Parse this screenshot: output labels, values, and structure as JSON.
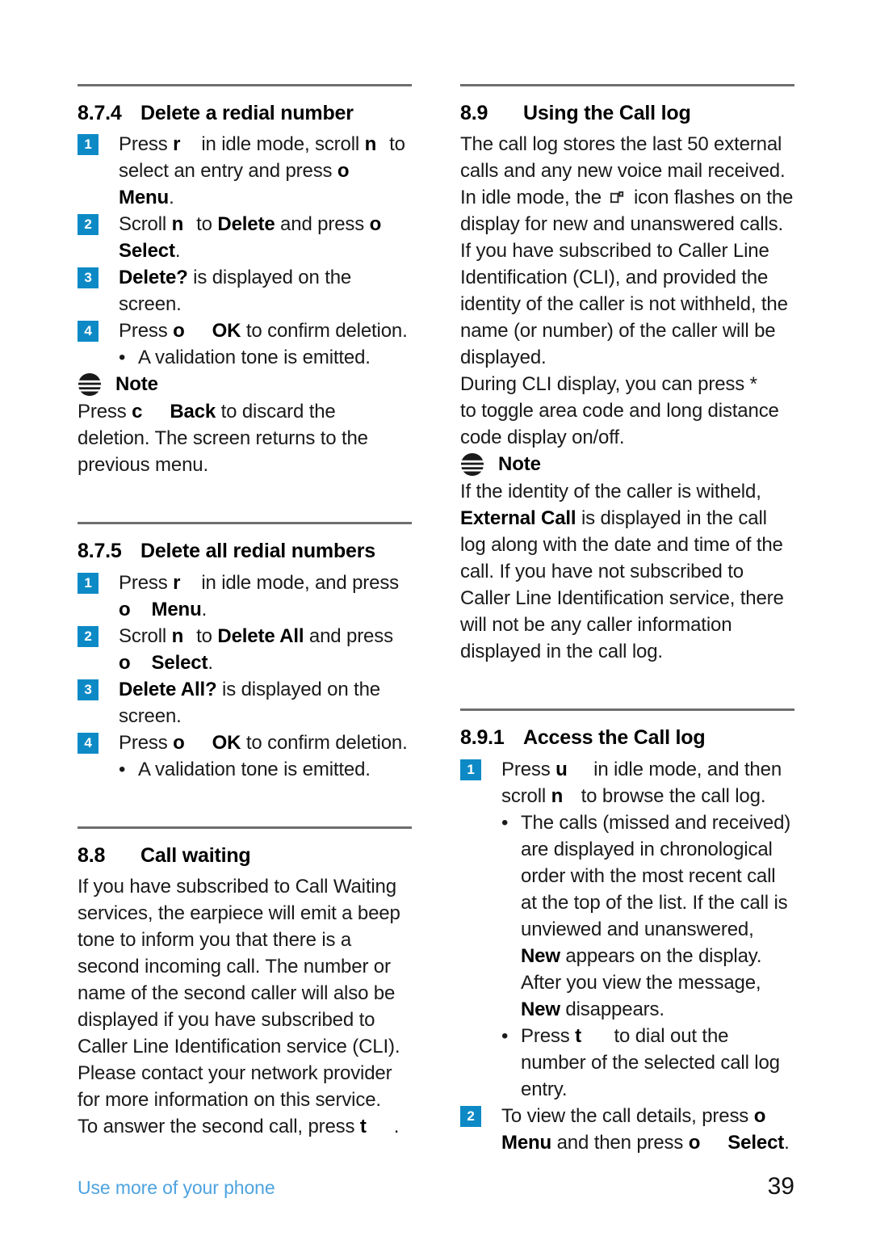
{
  "colors": {
    "badge_blue": "#0d8ac6",
    "footer_blue": "#4ea3e0",
    "rule_gray": "#6e6e6e",
    "text": "#1a1a1a"
  },
  "footer": {
    "chapter": "Use more of your phone",
    "page_number": "39"
  },
  "left_column": {
    "section_874": {
      "number": "8.7.4",
      "title": "Delete a redial number",
      "steps": [
        {
          "badge": "1",
          "parts": [
            {
              "t": "Press ",
              "b": false
            },
            {
              "t": "r",
              "b": true
            },
            {
              "t": "gap",
              "b": false
            },
            {
              "t": " in idle mode, scroll ",
              "b": false
            },
            {
              "t": "n",
              "b": true
            },
            {
              "t": "gap",
              "b": false
            },
            {
              "t": " to select an entry and press ",
              "b": false
            },
            {
              "t": "o",
              "b": true
            },
            {
              "t": "break",
              "b": false
            },
            {
              "t": "Menu",
              "b": true
            },
            {
              "t": ".",
              "b": false
            }
          ],
          "plain": "Press r in idle mode, scroll n to select an entry and press o Menu."
        },
        {
          "badge": "2",
          "plain": "Scroll n to Delete and press o Select."
        },
        {
          "badge": "3",
          "plain": "Delete? is displayed on the screen."
        },
        {
          "badge": "4",
          "plain": "Press o OK to confirm deletion."
        }
      ],
      "bullet": "A validation tone is emitted.",
      "note_label": "Note",
      "note_text": "Press c Back to discard the deletion. The screen returns to the previous menu."
    },
    "section_875": {
      "number": "8.7.5",
      "title": "Delete all redial numbers",
      "steps": [
        {
          "badge": "1",
          "plain": "Press r in idle mode, and press o Menu."
        },
        {
          "badge": "2",
          "plain": "Scroll n to Delete All and press o Select."
        },
        {
          "badge": "3",
          "plain": "Delete All? is displayed on the screen."
        },
        {
          "badge": "4",
          "plain": "Press o OK to confirm deletion."
        }
      ],
      "bullet": "A validation tone is emitted."
    },
    "section_88": {
      "number": "8.8",
      "title": "Call waiting",
      "paragraph1": "If you have subscribed to Call Waiting services, the earpiece will emit a beep tone to inform you that there is a second incoming call. The number or name of the second caller will also be displayed if you have subscribed to Caller Line Identification service (CLI). Please contact your network provider for more information on this service.",
      "paragraph2_pre": "To answer the second call, press ",
      "paragraph2_key": "t",
      "paragraph2_post": "."
    }
  },
  "right_column": {
    "section_89": {
      "number": "8.9",
      "title": "Using the Call log",
      "paragraph1_a": "The call log stores the last 50 external calls and any new voice mail received. In idle mode, the ",
      "paragraph1_icon_name": "missed-call-handset-icon",
      "paragraph1_b": " icon flashes on the display for new and unanswered calls. If you have subscribed to Caller Line Identification (CLI), and provided the identity of the caller is not withheld, the name (or number) of the caller will be displayed.",
      "paragraph2_pre": "During CLI display, you can press ",
      "paragraph2_key": "*",
      "paragraph2_post": " to toggle area code and long distance code display on/off.",
      "note_label": "Note",
      "note_pre": "If the identity of the caller is witheld, ",
      "note_bold": "External Call",
      "note_post": " is displayed in the call log along with the date and time of the call. If you have not subscribed to Caller Line Identification service, there will not be any caller information displayed in the call log."
    },
    "section_891": {
      "number": "8.9.1",
      "title": "Access the Call log",
      "step1": {
        "badge": "1",
        "pre": "Press ",
        "key1": "u",
        "mid": " in idle mode, and then scroll ",
        "key2": "n",
        "post": " to browse the call log."
      },
      "bullet1_pre": "The calls (missed and received) are displayed in chronological order with the most recent call at the top of the list. If the call is unviewed and unanswered, ",
      "bullet1_bold1": "New",
      "bullet1_mid": " appears on the display. After you view the message, ",
      "bullet1_bold2": "New",
      "bullet1_post": " disappears.",
      "bullet2_pre": "Press ",
      "bullet2_key": "t",
      "bullet2_post": " to dial out the number of the selected call log entry.",
      "step2": {
        "badge": "2",
        "pre": "To view the call details, press ",
        "key1": "o",
        "bold1": "Menu",
        "mid": " and then press ",
        "key2": "o",
        "bold2": "Select",
        "post": "."
      }
    }
  }
}
